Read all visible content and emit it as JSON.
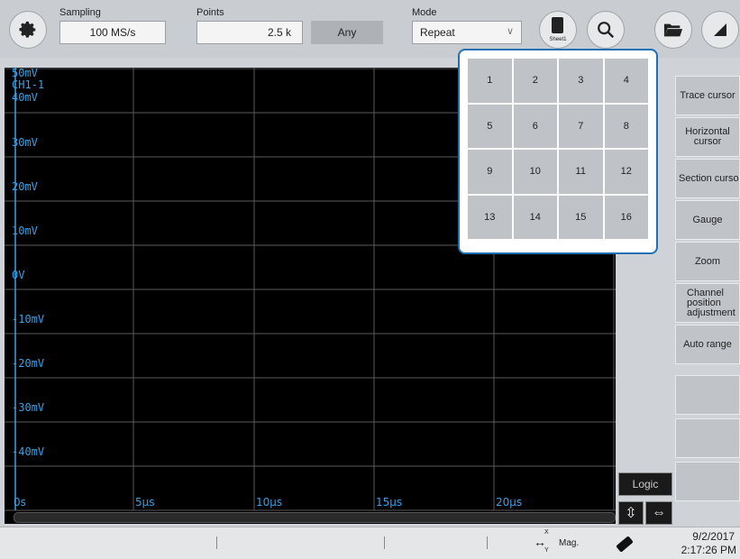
{
  "toolbar": {
    "sampling_label": "Sampling",
    "sampling_value": "100 MS/s",
    "points_label": "Points",
    "points_value": "2.5 k",
    "any_label": "Any",
    "mode_label": "Mode",
    "mode_value": "Repeat",
    "sheet_label": "Sheet1"
  },
  "plot": {
    "y_labels": [
      "50mV",
      "CH1-1",
      "40mV",
      "30mV",
      "20mV",
      "10mV",
      "0V",
      "-10mV",
      "-20mV",
      "-30mV",
      "-40mV"
    ],
    "x_labels": [
      "0s",
      "5µs",
      "10µs",
      "15µs",
      "20µs"
    ],
    "logic_label": "Logic"
  },
  "popup": {
    "cells": [
      "1",
      "2",
      "3",
      "4",
      "5",
      "6",
      "7",
      "8",
      "9",
      "10",
      "11",
      "12",
      "13",
      "14",
      "15",
      "16"
    ]
  },
  "right_panel": {
    "buttons": [
      "Trace cursor",
      "Horizontal cursor",
      "Section cursor",
      "Gauge",
      "Zoom",
      "Channel position adjustment",
      "Auto range",
      "",
      "",
      ""
    ]
  },
  "status": {
    "mag_label": "Mag.",
    "x_label": "X",
    "y_label": "Y",
    "date": "9/2/2017",
    "time": "2:17:26 PM"
  },
  "colors": {
    "trace": "#3aa0e8",
    "popup_border": "#1f6fb5"
  }
}
